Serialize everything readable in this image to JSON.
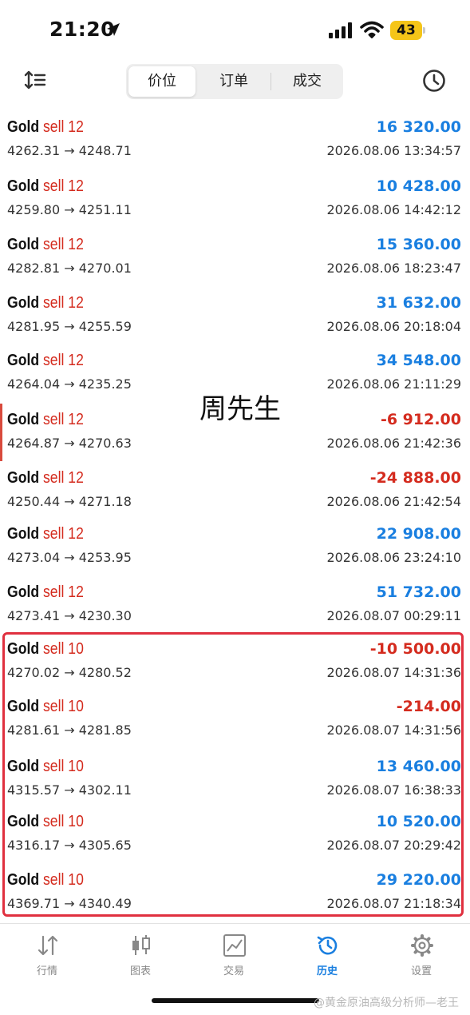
{
  "status_bar": {
    "time": "21:20",
    "battery": "43"
  },
  "toolbar": {
    "tabs": [
      "价位",
      "订单",
      "成交"
    ],
    "active_tab": 0
  },
  "rows": [
    {
      "symbol": "Gold",
      "side": "sell",
      "volume": "12",
      "price": "4262.31 → 4248.71",
      "profit": "16 320.00",
      "datetime": "2026.08.06 13:34:57"
    },
    {
      "symbol": "Gold",
      "side": "sell",
      "volume": "12",
      "price": "4259.80 → 4251.11",
      "profit": "10 428.00",
      "datetime": "2026.08.06 14:42:12"
    },
    {
      "symbol": "Gold",
      "side": "sell",
      "volume": "12",
      "price": "4282.81 → 4270.01",
      "profit": "15 360.00",
      "datetime": "2026.08.06 18:23:47"
    },
    {
      "symbol": "Gold",
      "side": "sell",
      "volume": "12",
      "price": "4281.95 → 4255.59",
      "profit": "31 632.00",
      "datetime": "2026.08.06 20:18:04"
    },
    {
      "symbol": "Gold",
      "side": "sell",
      "volume": "12",
      "price": "4264.04 → 4235.25",
      "profit": "34 548.00",
      "datetime": "2026.08.06 21:11:29"
    },
    {
      "symbol": "Gold",
      "side": "sell",
      "volume": "12",
      "price": "4264.87 → 4270.63",
      "profit": "-6 912.00",
      "datetime": "2026.08.06 21:42:36"
    },
    {
      "symbol": "Gold",
      "side": "sell",
      "volume": "12",
      "price": "4250.44 → 4271.18",
      "profit": "-24 888.00",
      "datetime": "2026.08.06 21:42:54"
    },
    {
      "symbol": "Gold",
      "side": "sell",
      "volume": "12",
      "price": "4273.04 → 4253.95",
      "profit": "22 908.00",
      "datetime": "2026.08.06 23:24:10"
    },
    {
      "symbol": "Gold",
      "side": "sell",
      "volume": "12",
      "price": "4273.41 → 4230.30",
      "profit": "51 732.00",
      "datetime": "2026.08.07 00:29:11"
    },
    {
      "symbol": "Gold",
      "side": "sell",
      "volume": "10",
      "price": "4270.02 → 4280.52",
      "profit": "-10 500.00",
      "datetime": "2026.08.07 14:31:36"
    },
    {
      "symbol": "Gold",
      "side": "sell",
      "volume": "10",
      "price": "4281.61 → 4281.85",
      "profit": "-214.00",
      "datetime": "2026.08.07 14:31:56"
    },
    {
      "symbol": "Gold",
      "side": "sell",
      "volume": "10",
      "price": "4315.57 → 4302.11",
      "profit": "13 460.00",
      "datetime": "2026.08.07 16:38:33"
    },
    {
      "symbol": "Gold",
      "side": "sell",
      "volume": "10",
      "price": "4316.17 → 4305.65",
      "profit": "10 520.00",
      "datetime": "2026.08.07 20:29:42"
    },
    {
      "symbol": "Gold",
      "side": "sell",
      "volume": "10",
      "price": "4369.71 → 4340.49",
      "profit": "29 220.00",
      "datetime": "2026.08.07 21:18:34"
    }
  ],
  "overlay_text": "周先生",
  "bottom_nav": {
    "items": [
      {
        "label": "行情",
        "icon": "quotes-arrows-icon"
      },
      {
        "label": "图表",
        "icon": "candlestick-chart-icon"
      },
      {
        "label": "交易",
        "icon": "trade-chart-icon"
      },
      {
        "label": "历史",
        "icon": "history-clock-icon"
      },
      {
        "label": "设置",
        "icon": "settings-gear-icon"
      }
    ],
    "active_index": 3
  },
  "watermark": "@黄金原油高级分析师—老王",
  "colors": {
    "profit_positive": "#1a7fe0",
    "profit_negative": "#d42b1e",
    "highlight_border": "#e0303f",
    "active_nav": "#1a7fe0"
  }
}
